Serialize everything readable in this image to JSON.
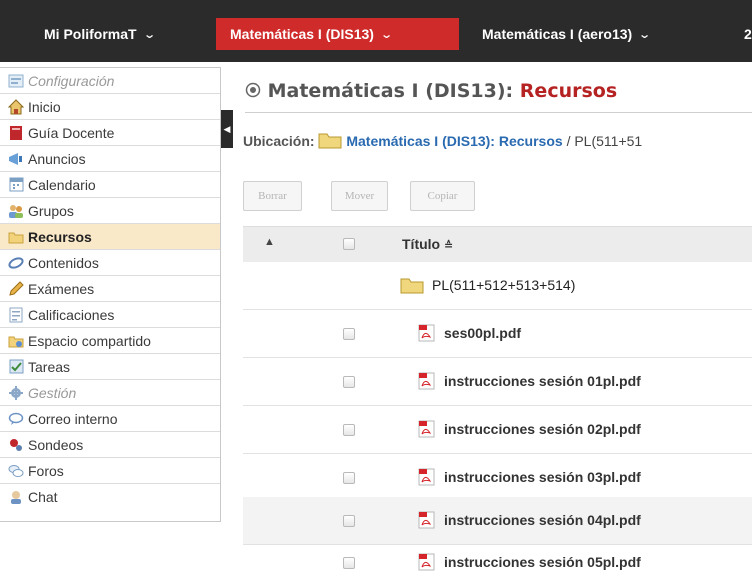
{
  "topbar": {
    "sites": [
      {
        "label": "Mi PoliformaT",
        "active": false
      },
      {
        "label": "Matemáticas I (DIS13)",
        "active": true
      },
      {
        "label": "Matemáticas I (aero13)",
        "active": false
      },
      {
        "label": "2",
        "active": false
      }
    ],
    "chevron_icon": "chevron-down-icon",
    "accent_color": "#cf2b2b",
    "bar_color": "#2b2b2b"
  },
  "sidebar": {
    "items": [
      {
        "label": "Configuración",
        "icon": "settings-icon",
        "type": "section"
      },
      {
        "label": "Inicio",
        "icon": "home-icon",
        "type": "link"
      },
      {
        "label": "Guía Docente",
        "icon": "book-icon",
        "type": "link"
      },
      {
        "label": "Anuncios",
        "icon": "announcements-icon",
        "type": "link"
      },
      {
        "label": "Calendario",
        "icon": "calendar-icon",
        "type": "link"
      },
      {
        "label": "Grupos",
        "icon": "groups-icon",
        "type": "link"
      },
      {
        "label": "Recursos",
        "icon": "folder-icon",
        "type": "active"
      },
      {
        "label": "Contenidos",
        "icon": "contents-icon",
        "type": "link"
      },
      {
        "label": "Exámenes",
        "icon": "pencil-icon",
        "type": "link"
      },
      {
        "label": "Calificaciones",
        "icon": "gradebook-icon",
        "type": "link"
      },
      {
        "label": "Espacio compartido",
        "icon": "shared-space-icon",
        "type": "link"
      },
      {
        "label": "Tareas",
        "icon": "tasks-icon",
        "type": "link"
      },
      {
        "label": "Gestión",
        "icon": "gear-icon",
        "type": "section"
      },
      {
        "label": "Correo interno",
        "icon": "mail-bubble-icon",
        "type": "link"
      },
      {
        "label": "Sondeos",
        "icon": "polls-icon",
        "type": "link"
      },
      {
        "label": "Foros",
        "icon": "forums-icon",
        "type": "link"
      },
      {
        "label": "Chat",
        "icon": "chat-icon",
        "type": "link"
      }
    ],
    "active_color": "#f9e9c9"
  },
  "main": {
    "title_site": "Matemáticas I (DIS13):",
    "title_tool": "Recursos",
    "breadcrumb": {
      "label": "Ubicación:",
      "folder": "Matemáticas I (DIS13): Recursos",
      "separator": "/",
      "current": "PL(511+51"
    },
    "buttons": {
      "delete": "Borrar",
      "move": "Mover",
      "copy": "Copiar"
    },
    "table": {
      "title_header": "Título",
      "folder": {
        "name": "PL(511+512+513+514)",
        "icon": "folder-icon"
      },
      "files": [
        {
          "name": "ses00pl.pdf",
          "icon": "pdf-icon"
        },
        {
          "name": "instrucciones sesión 01pl.pdf",
          "icon": "pdf-icon"
        },
        {
          "name": "instrucciones sesión 02pl.pdf",
          "icon": "pdf-icon"
        },
        {
          "name": "instrucciones sesión 03pl.pdf",
          "icon": "pdf-icon"
        },
        {
          "name": "instrucciones sesión 04pl.pdf",
          "icon": "pdf-icon"
        },
        {
          "name": "instrucciones sesión 05pl.pdf",
          "icon": "pdf-icon"
        }
      ]
    }
  }
}
